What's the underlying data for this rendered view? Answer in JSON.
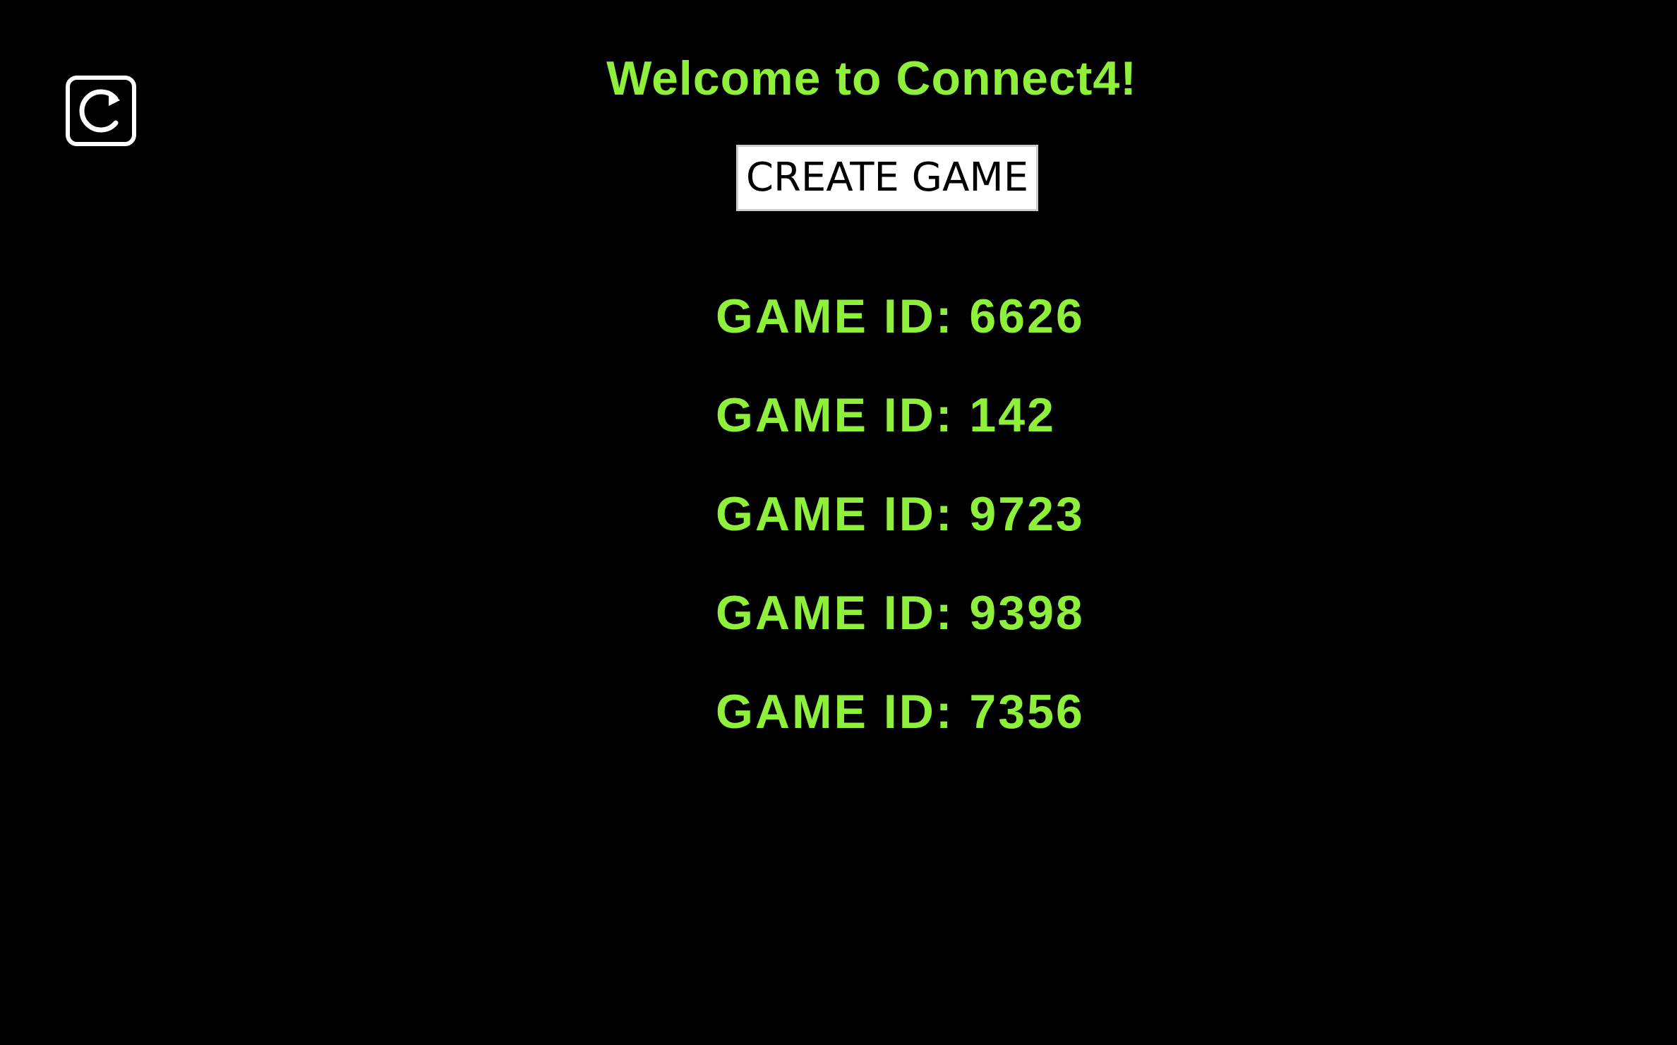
{
  "app": {
    "title": "Welcome to Connect4!",
    "refresh_icon": "refresh-icon",
    "create_button_label": "CREATE GAME"
  },
  "games": [
    {
      "label": "GAME ID: 6626"
    },
    {
      "label": "GAME ID: 142"
    },
    {
      "label": "GAME ID: 9723"
    },
    {
      "label": "GAME ID: 9398"
    },
    {
      "label": "GAME ID: 7356"
    }
  ],
  "colors": {
    "background": "#000000",
    "accent": "#8ff03b",
    "button_bg": "#ffffff",
    "icon": "#ffffff"
  }
}
